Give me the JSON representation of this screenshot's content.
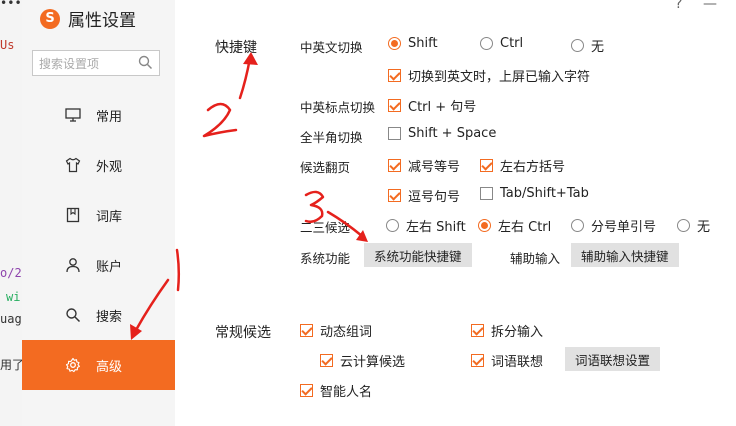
{
  "background_strip": {
    "texts": [
      "•••",
      "Us",
      "o/2",
      "wi",
      "uag",
      "用了"
    ]
  },
  "app": {
    "logo_char": "S",
    "title": "属性设置"
  },
  "search": {
    "placeholder": "搜索设置项"
  },
  "nav": [
    {
      "label": "常用",
      "icon": "monitor-icon",
      "active": false
    },
    {
      "label": "外观",
      "icon": "tshirt-icon",
      "active": false
    },
    {
      "label": "词库",
      "icon": "book-icon",
      "active": false
    },
    {
      "label": "账户",
      "icon": "user-icon",
      "active": false
    },
    {
      "label": "搜索",
      "icon": "search-icon",
      "active": false
    },
    {
      "label": "高级",
      "icon": "gear-icon",
      "active": true
    }
  ],
  "window_controls": {
    "help": "?",
    "min": "—"
  },
  "shortcuts": {
    "section_label": "快捷键",
    "lang_switch": {
      "label": "中英文切换",
      "options": [
        "Shift",
        "Ctrl",
        "无"
      ],
      "selected": "Shift"
    },
    "lang_switch_extra": {
      "label": "切换到英文时，上屏已输入字符",
      "checked": true
    },
    "punct_switch": {
      "label": "中英标点切换",
      "option": "Ctrl + 句号",
      "checked": true
    },
    "width_switch": {
      "label": "全半角切换",
      "option": "Shift + Space",
      "checked": false
    },
    "page_turn": {
      "label": "候选翻页",
      "options": [
        {
          "label": "减号等号",
          "checked": true
        },
        {
          "label": "左右方括号",
          "checked": true
        },
        {
          "label": "逗号句号",
          "checked": true
        },
        {
          "label": "Tab/Shift+Tab",
          "checked": false
        }
      ]
    },
    "second_candidate": {
      "label": "二三候选",
      "options": [
        "左右 Shift",
        "左右 Ctrl",
        "分号单引号",
        "无"
      ],
      "selected": "左右 Ctrl"
    },
    "system": {
      "label": "系统功能",
      "button": "系统功能快捷键",
      "assist_label": "辅助输入",
      "assist_button": "辅助输入快捷键"
    }
  },
  "candidates": {
    "section_label": "常规候选",
    "dynamic_phrase": {
      "label": "动态组词",
      "checked": true
    },
    "split_input": {
      "label": "拆分输入",
      "checked": true
    },
    "cloud": {
      "label": "云计算候选",
      "checked": true
    },
    "association": {
      "label": "词语联想",
      "checked": true,
      "button": "词语联想设置"
    },
    "smart_name": {
      "label": "智能人名",
      "checked": true
    }
  },
  "annotations": {
    "color": "#e5211c",
    "numbers": [
      "2",
      "3"
    ]
  }
}
